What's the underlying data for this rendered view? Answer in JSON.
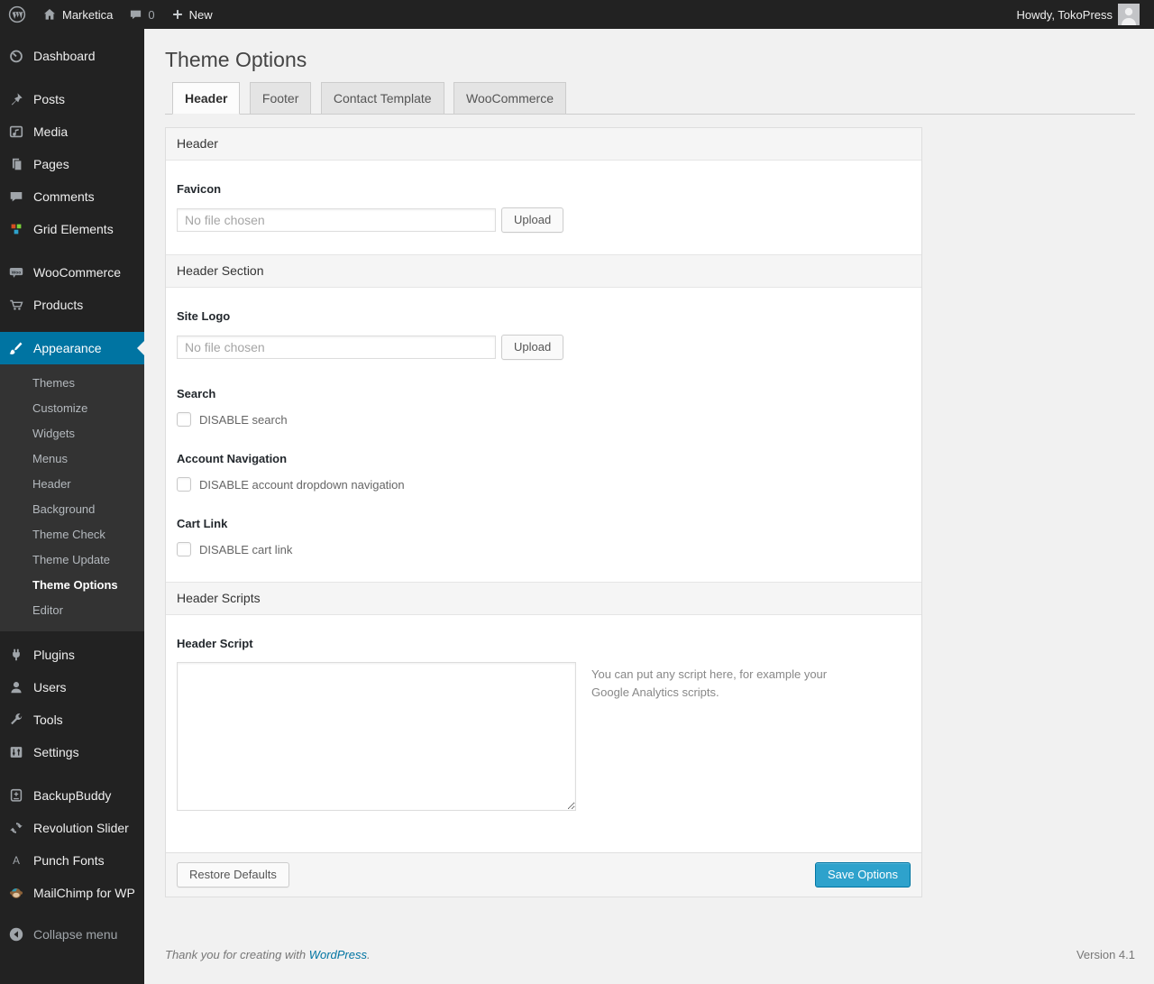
{
  "admin_bar": {
    "site_name": "Marketica",
    "comments_count": "0",
    "new_label": "New",
    "howdy": "Howdy, TokoPress"
  },
  "sidebar": {
    "items": [
      {
        "label": "Dashboard"
      },
      {
        "label": "Posts"
      },
      {
        "label": "Media"
      },
      {
        "label": "Pages"
      },
      {
        "label": "Comments"
      },
      {
        "label": "Grid Elements"
      },
      {
        "label": "WooCommerce"
      },
      {
        "label": "Products"
      },
      {
        "label": "Appearance",
        "active": true
      },
      {
        "label": "Plugins"
      },
      {
        "label": "Users"
      },
      {
        "label": "Tools"
      },
      {
        "label": "Settings"
      },
      {
        "label": "BackupBuddy"
      },
      {
        "label": "Revolution Slider"
      },
      {
        "label": "Punch Fonts"
      },
      {
        "label": "MailChimp for WP"
      }
    ],
    "appearance_submenu": [
      {
        "label": "Themes"
      },
      {
        "label": "Customize"
      },
      {
        "label": "Widgets"
      },
      {
        "label": "Menus"
      },
      {
        "label": "Header"
      },
      {
        "label": "Background"
      },
      {
        "label": "Theme Check"
      },
      {
        "label": "Theme Update"
      },
      {
        "label": "Theme Options",
        "current": true
      },
      {
        "label": "Editor"
      }
    ],
    "collapse_label": "Collapse menu"
  },
  "page": {
    "title": "Theme Options",
    "tabs": [
      {
        "label": "Header",
        "active": true
      },
      {
        "label": "Footer",
        "active": false
      },
      {
        "label": "Contact Template",
        "active": false
      },
      {
        "label": "WooCommerce",
        "active": false
      }
    ]
  },
  "panel": {
    "sections": {
      "header": "Header",
      "header_section": "Header Section",
      "header_scripts": "Header Scripts"
    },
    "favicon": {
      "label": "Favicon",
      "placeholder": "No file chosen",
      "value": "",
      "button": "Upload"
    },
    "site_logo": {
      "label": "Site Logo",
      "placeholder": "No file chosen",
      "value": "",
      "button": "Upload"
    },
    "search": {
      "label": "Search",
      "checkbox": "DISABLE search",
      "checked": false
    },
    "account_navigation": {
      "label": "Account Navigation",
      "checkbox": "DISABLE account dropdown navigation",
      "checked": false
    },
    "cart_link": {
      "label": "Cart Link",
      "checkbox": "DISABLE cart link",
      "checked": false
    },
    "header_script": {
      "label": "Header Script",
      "value": "",
      "help": "You can put any script here, for example your Google Analytics scripts."
    },
    "actions": {
      "restore": "Restore Defaults",
      "save": "Save Options"
    }
  },
  "page_footer": {
    "thanks_prefix": "Thank you for creating with ",
    "link": "WordPress",
    "suffix": ".",
    "version": "Version 4.1"
  },
  "colors": {
    "accent": "#0074a2",
    "primary_button": "#2ea2cc",
    "admin_bar_bg": "#222222",
    "submenu_bg": "#333333",
    "content_bg": "#f1f1f1"
  }
}
